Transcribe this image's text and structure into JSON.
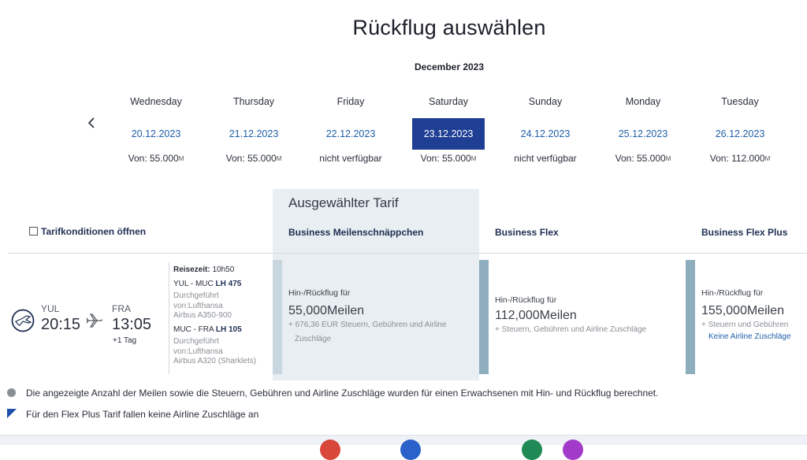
{
  "page": {
    "title": "Rückflug auswählen",
    "month": "December 2023"
  },
  "calendar": {
    "days": [
      {
        "weekday": "Wednesday",
        "date": "20.12.2023",
        "price": "Von: 55.000",
        "selected": false
      },
      {
        "weekday": "Thursday",
        "date": "21.12.2023",
        "price": "Von: 55.000",
        "selected": false
      },
      {
        "weekday": "Friday",
        "date": "22.12.2023",
        "price": "nicht verfügbar",
        "selected": false
      },
      {
        "weekday": "Saturday",
        "date": "23.12.2023",
        "price": "Von: 55.000",
        "selected": true
      },
      {
        "weekday": "Sunday",
        "date": "24.12.2023",
        "price": "nicht verfügbar",
        "selected": false
      },
      {
        "weekday": "Monday",
        "date": "25.12.2023",
        "price": "Von: 55.000",
        "selected": false
      },
      {
        "weekday": "Tuesday",
        "date": "26.12.2023",
        "price": "Von: 112.000",
        "selected": false
      }
    ],
    "miles_symbol": "M"
  },
  "fares": {
    "tarif_link": "Tarifkonditionen öffnen",
    "selected_label": "Ausgewählter Tarif",
    "columns": [
      {
        "name": "Business Meilenschnäppchen",
        "intro": "Hin-/Rückflug für",
        "miles": "55,000",
        "miles_unit": "Meilen",
        "note1": "+ 676,36 EUR Steuern, Gebühren und Airline",
        "note2": "Zuschläge",
        "link": ""
      },
      {
        "name": "Business Flex",
        "intro": "Hin-/Rückflug für",
        "miles": "112,000",
        "miles_unit": "Meilen",
        "note1": "+ Steuern, Gebühren und Airline Zuschläge",
        "note2": "",
        "link": ""
      },
      {
        "name": "Business Flex Plus",
        "intro": "Hin-/Rückflug für",
        "miles": "155,000",
        "miles_unit": "Meilen",
        "note1": "+ Steuern und Gebühren",
        "note2": "",
        "link": "Keine Airline Zuschläge"
      }
    ]
  },
  "flight": {
    "from_code": "YUL",
    "from_time": "20:15",
    "to_code": "FRA",
    "to_time": "13:05",
    "day_offset": "+1 Tag",
    "travel_time_label": "Reisezeit:",
    "travel_time": "10h50",
    "segments": [
      {
        "route": "YUL - MUC",
        "flight_no": "LH 475",
        "operated_label": "Durchgeführt",
        "operator": "von:Lufthansa",
        "aircraft": "Airbus A350-900"
      },
      {
        "route": "MUC - FRA",
        "flight_no": "LH 105",
        "operated_label": "Durchgeführt",
        "operator": "von:Lufthansa",
        "aircraft": "Airbus A320 (Sharklets)"
      }
    ]
  },
  "info": {
    "line1": "Die angezeigte Anzahl der Meilen sowie die Steuern, Gebühren und Airline Zuschläge wurden für einen Erwachsenen mit Hin- und Rückflug berechnet.",
    "line2": "Für den Flex Plus Tarif fallen keine Airline Zuschläge an"
  },
  "colors": {
    "accent": "#1f3f94",
    "link": "#1d5fa8",
    "fare_bar": "#8eaec0",
    "selected_panel": "#e8eef2"
  }
}
